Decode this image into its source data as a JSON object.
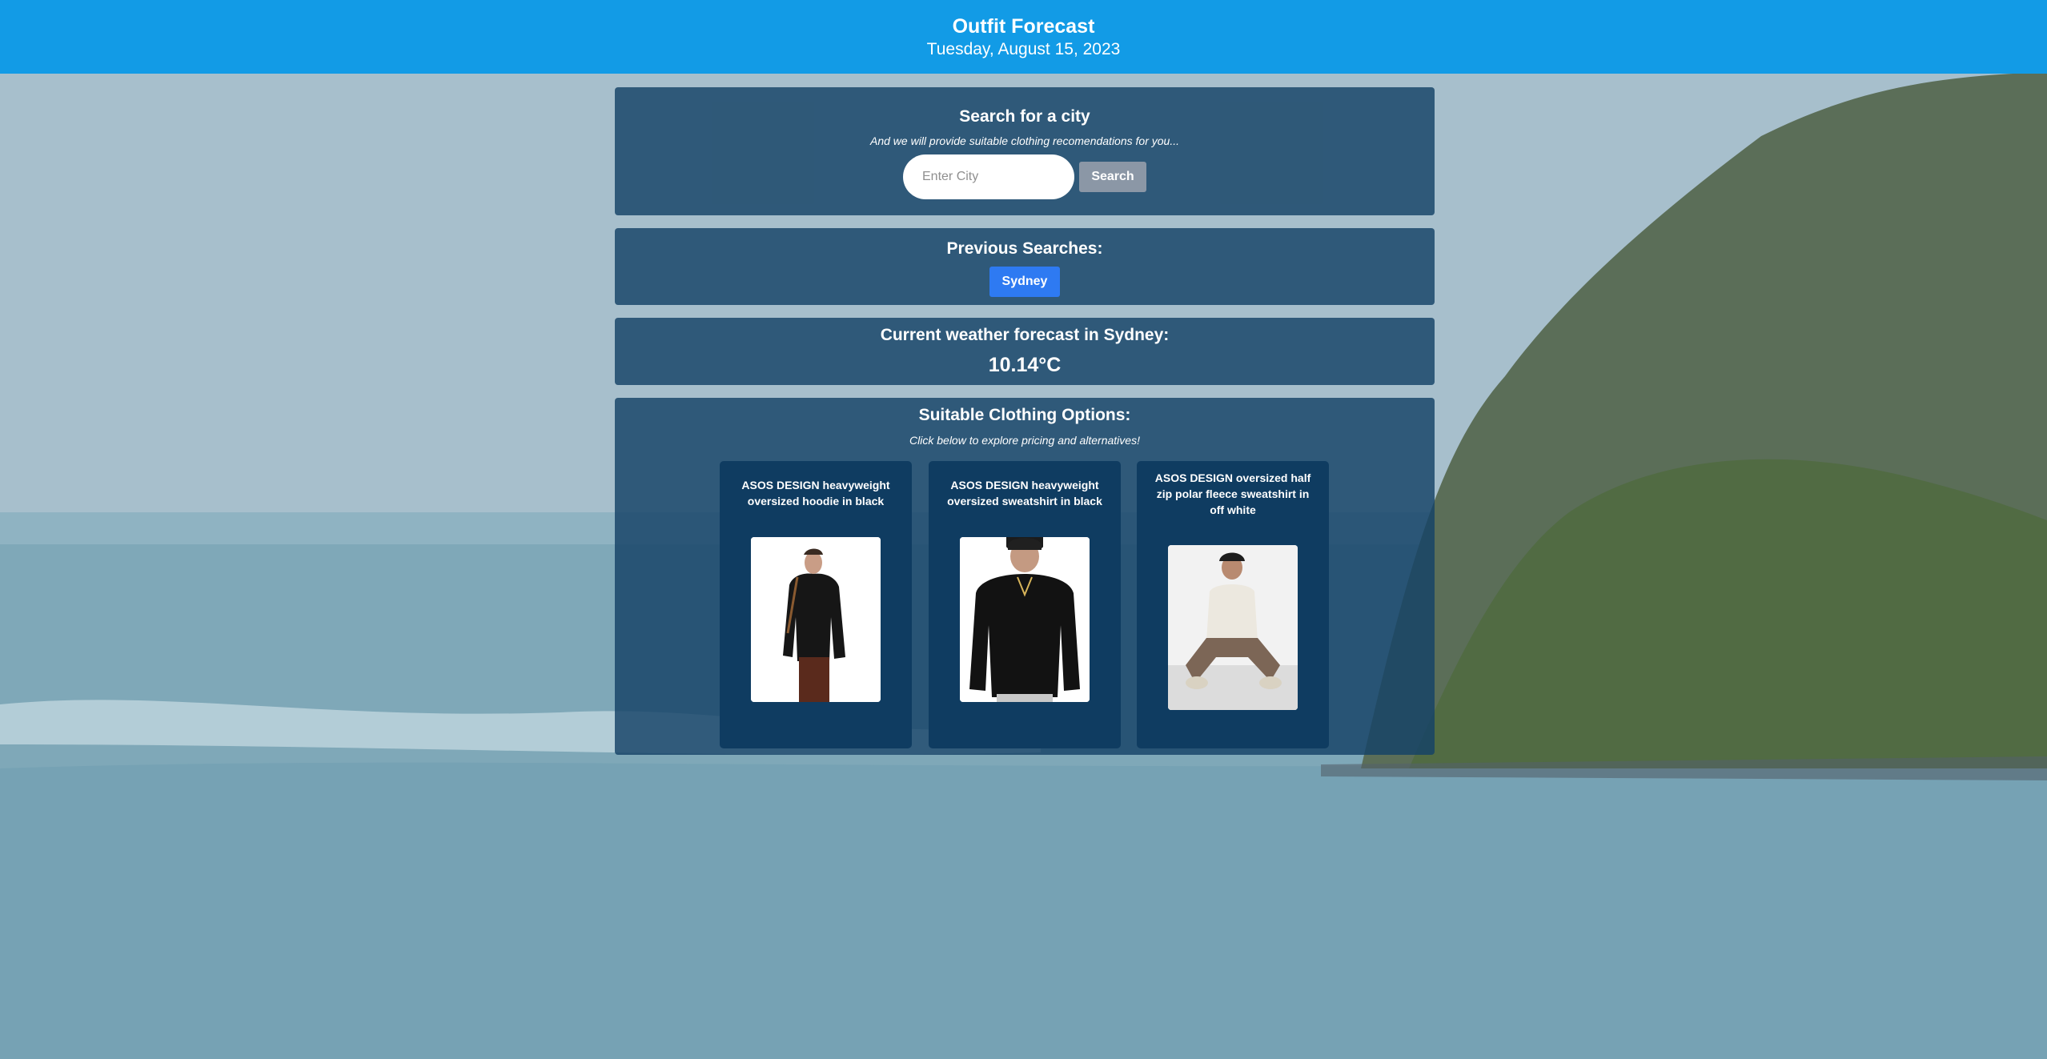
{
  "header": {
    "title": "Outfit Forecast",
    "date": "Tuesday, August 15, 2023"
  },
  "search": {
    "heading": "Search for a city",
    "subtitle": "And we will provide suitable clothing recomendations for you...",
    "placeholder": "Enter City",
    "button_label": "Search"
  },
  "previous": {
    "heading": "Previous Searches:",
    "items": [
      "Sydney"
    ]
  },
  "weather": {
    "heading": "Current weather forecast in Sydney:",
    "temperature": "10.14°C"
  },
  "clothing": {
    "heading": "Suitable Clothing Options:",
    "subtitle": "Click below to explore pricing and alternatives!",
    "items": [
      {
        "title": "ASOS DESIGN heavyweight oversized hoodie in black",
        "image": "model-black-hoodie-photo"
      },
      {
        "title": "ASOS DESIGN heavyweight oversized sweatshirt in black",
        "image": "model-black-sweatshirt-photo"
      },
      {
        "title": "ASOS DESIGN oversized half zip polar fleece sweatshirt in off white",
        "image": "model-offwhite-fleece-photo"
      }
    ]
  },
  "colors": {
    "header_bg": "#129be6",
    "panel_bg": "#154266",
    "card_bg": "#0f3c61",
    "search_button": "#8b97a6",
    "history_button": "#2e7af2"
  }
}
